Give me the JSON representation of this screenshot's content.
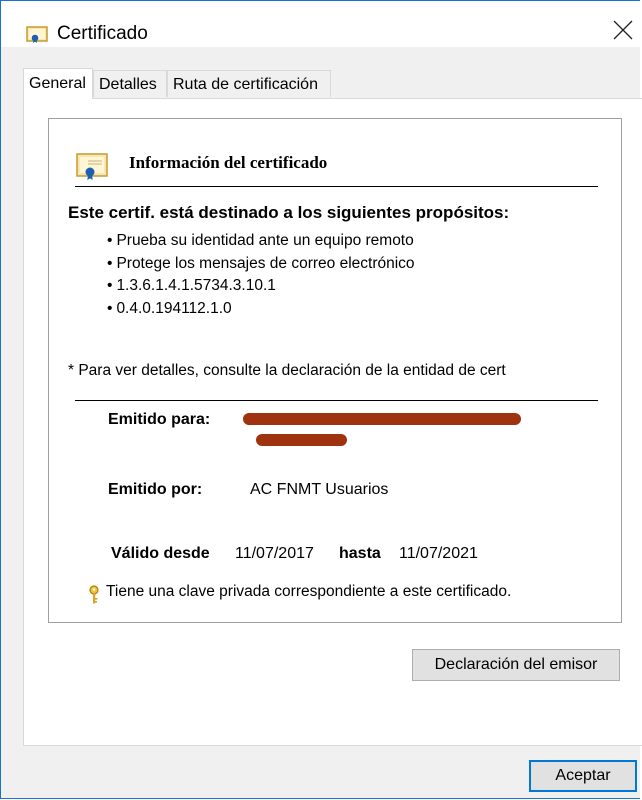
{
  "window": {
    "title": "Certificado",
    "icon": "certificate-icon",
    "close_icon": "close-icon"
  },
  "tabs": [
    {
      "label": "General",
      "active": true
    },
    {
      "label": "Detalles",
      "active": false
    },
    {
      "label": "Ruta de certificación",
      "active": false
    }
  ],
  "panel": {
    "heading": "Información del certificado",
    "purposes_heading": "Este certif. está destinado a los siguientes propósitos:",
    "purposes": [
      "Prueba su identidad ante un equipo remoto",
      "Protege los mensajes de correo electrónico",
      "1.3.6.1.4.1.5734.3.10.1",
      "0.4.0.194112.1.0"
    ],
    "details_note": "* Para ver detalles, consulte la declaración de la entidad de cert",
    "issued_to_label": "Emitido para:",
    "issued_to_value": "[redacted]",
    "issued_by_label": "Emitido por:",
    "issued_by_value": "AC FNMT Usuarios",
    "valid_from_label": "Válido desde",
    "valid_from": "11/07/2017",
    "valid_to_label": "hasta",
    "valid_to": "11/07/2021",
    "private_key_note": "Tiene una clave privada correspondiente a este certificado."
  },
  "buttons": {
    "issuer_statement": "Declaración del emisor",
    "ok": "Aceptar"
  },
  "colors": {
    "accent": "#0078d7",
    "redaction": "#a0330f",
    "window_bg": "#f0f0f0"
  }
}
